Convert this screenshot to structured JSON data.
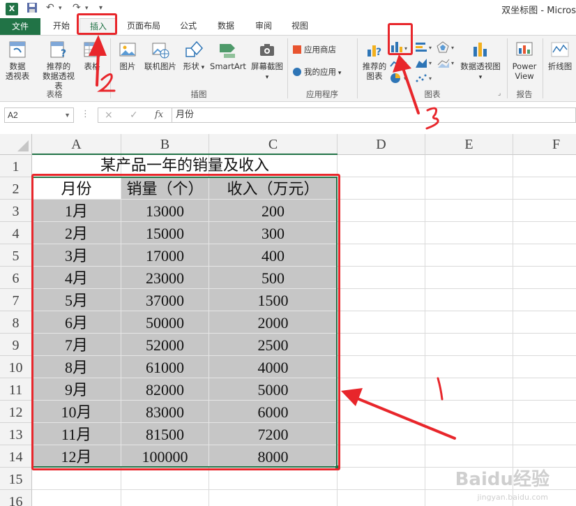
{
  "window": {
    "title": "双坐标图 - Micros",
    "app_icon": "X"
  },
  "quick_access": {
    "save_icon": "save-icon",
    "undo_icon": "undo-icon",
    "redo_icon": "redo-icon"
  },
  "tabs": [
    {
      "label": "文件"
    },
    {
      "label": "开始"
    },
    {
      "label": "插入"
    },
    {
      "label": "页面布局"
    },
    {
      "label": "公式"
    },
    {
      "label": "数据"
    },
    {
      "label": "审阅"
    },
    {
      "label": "视图"
    }
  ],
  "ribbon": {
    "tables_group": {
      "label": "表格",
      "pivot_line1": "数据",
      "pivot_line2": "透视表",
      "rec_pivot_line1": "推荐的",
      "rec_pivot_line2": "数据透视表",
      "table": "表格"
    },
    "illustrations_group": {
      "label": "插图",
      "pictures": "图片",
      "online_pictures": "联机图片",
      "shapes": "形状",
      "smartart": "SmartArt",
      "screenshot": "屏幕截图"
    },
    "apps_group": {
      "label": "应用程序",
      "store": "应用商店",
      "my_apps": "我的应用"
    },
    "charts_group": {
      "label": "图表",
      "recommended_line1": "推荐的",
      "recommended_line2": "图表",
      "pivot_chart": "数据透视图"
    },
    "reports_group": {
      "label": "报告",
      "power_view_line1": "Power",
      "power_view_line2": "View"
    },
    "sparklines": {
      "line": "折线图"
    }
  },
  "formula_bar": {
    "name_box": "A2",
    "cancel": "×",
    "confirm": "✓",
    "fx": "fx",
    "value": "月份"
  },
  "sheet": {
    "columns": [
      "A",
      "B",
      "C",
      "D",
      "E",
      "F"
    ],
    "rows": [
      "1",
      "2",
      "3",
      "4",
      "5",
      "6",
      "7",
      "8",
      "9",
      "10",
      "11",
      "12",
      "13",
      "14",
      "15",
      "16"
    ],
    "title": "某产品一年的销量及收入",
    "headers": [
      "月份",
      "销量（个）",
      "收入（万元）"
    ],
    "data": [
      [
        "1月",
        "13000",
        "200"
      ],
      [
        "2月",
        "15000",
        "300"
      ],
      [
        "3月",
        "17000",
        "400"
      ],
      [
        "4月",
        "23000",
        "500"
      ],
      [
        "5月",
        "37000",
        "1500"
      ],
      [
        "6月",
        "50000",
        "2000"
      ],
      [
        "7月",
        "52000",
        "2500"
      ],
      [
        "8月",
        "61000",
        "4000"
      ],
      [
        "9月",
        "82000",
        "5000"
      ],
      [
        "10月",
        "83000",
        "6000"
      ],
      [
        "11月",
        "81500",
        "7200"
      ],
      [
        "12月",
        "100000",
        "8000"
      ]
    ]
  },
  "annotations": {
    "step1": "1",
    "step2": "2",
    "step3": "3",
    "color": "#e8262b"
  },
  "watermark": {
    "brand": "Baidu经验",
    "url": "jingyan.baidu.com"
  },
  "colors": {
    "excel_green": "#217346",
    "selection_gray": "#c6c6c6",
    "ribbon_bg": "#f3f3f3"
  }
}
